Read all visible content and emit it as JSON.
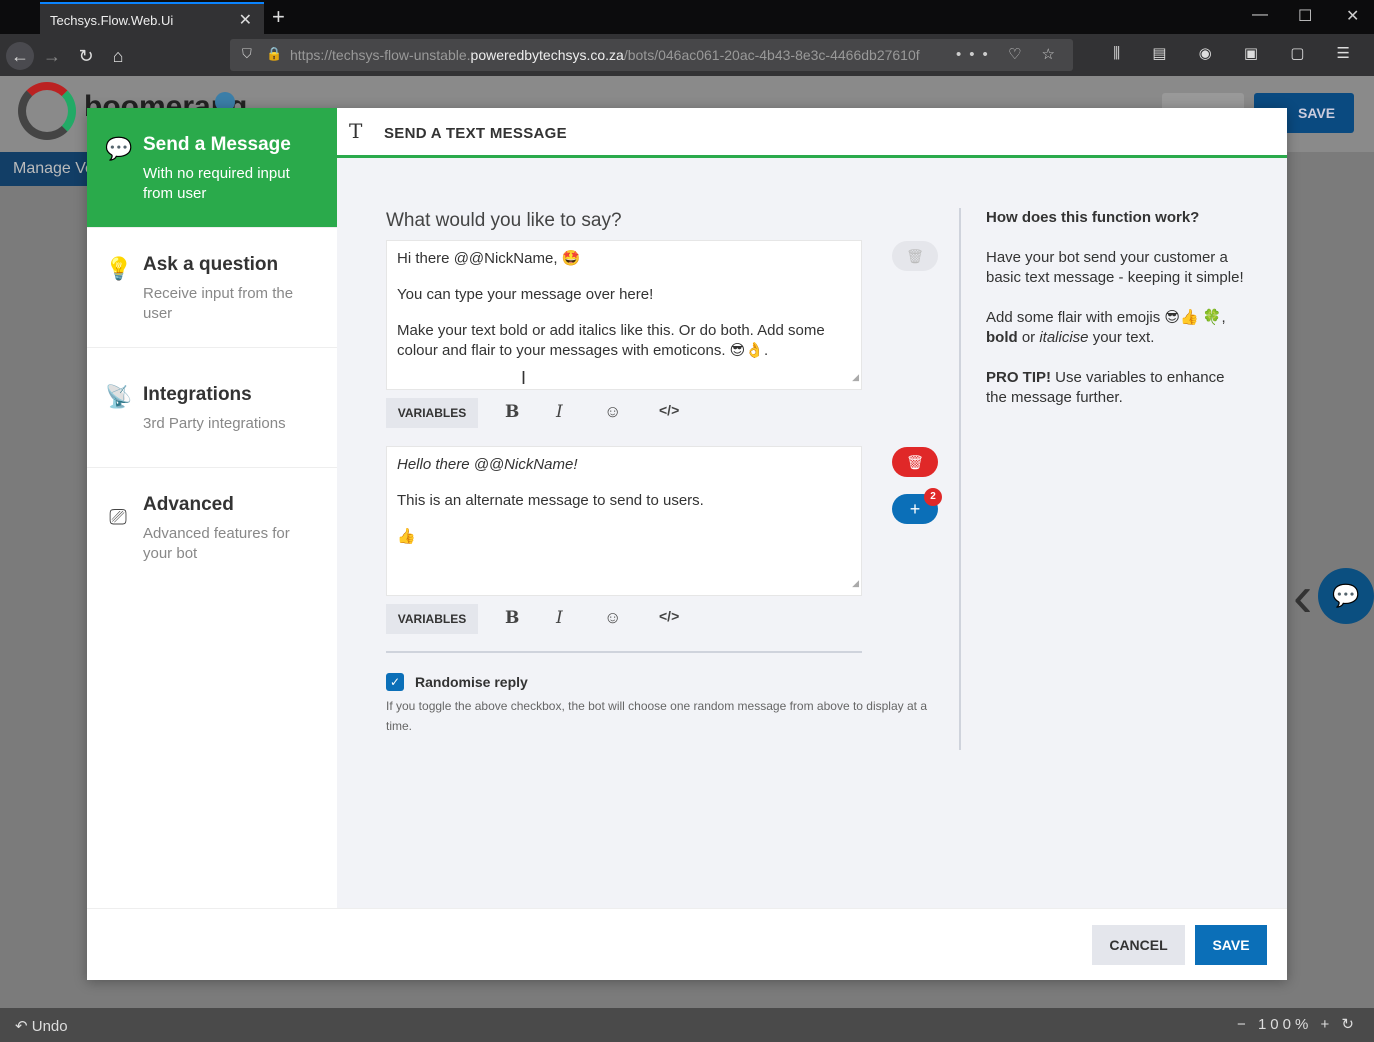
{
  "browser": {
    "tab_title": "Techsys.Flow.Web.Ui",
    "tab_close": "✕",
    "new_tab": "+",
    "url_prefix": "https://techsys-flow-unstable.",
    "url_host": "poweredbytechsys.co.za",
    "url_path": "/bots/046ac061-20ac-4b43-8e3c-4466db27610f",
    "url_actions": "••• ♡ ☆",
    "toolbar_icons": "⫼ ▤ ◉ ▣ ▢ ☰",
    "window_controls": [
      "—",
      "☐",
      "✕"
    ]
  },
  "background_app": {
    "logo_text": "boomerang",
    "save_label": "SAVE",
    "manage_label": "Manage Ve",
    "undo_label": "Undo",
    "zoom_level": "100%"
  },
  "sidebar": {
    "items": [
      {
        "title": "Send a Message",
        "desc": "With no required input from user",
        "icon": "chat-bubble-icon"
      },
      {
        "title": "Ask a question",
        "desc": "Receive input from the user",
        "icon": "lightbulb-icon"
      },
      {
        "title": "Integrations",
        "desc": "3rd Party integrations",
        "icon": "broadcast-icon"
      },
      {
        "title": "Advanced",
        "desc": "Advanced features for your bot",
        "icon": "cast-icon"
      }
    ]
  },
  "panel": {
    "title": "SEND A TEXT MESSAGE",
    "question": "What would you like to say?",
    "variables_label": "VARIABLES",
    "randomise_label": "Randomise reply",
    "randomise_checked": true,
    "randomise_help": "If you toggle the above checkbox, the bot will choose one random message from above to display at a time.",
    "add_badge": "2"
  },
  "messages": [
    {
      "lines": [
        "Hi there @@NickName, 🤩",
        "You can type your message over here!",
        "Make your text bold or add italics like this. Or do both. Add some colour and flair to your messages with emoticons. 😎👌."
      ]
    },
    {
      "lines": [
        "Hello there @@NickName!",
        "This is an alternate message to send to users.",
        "👍"
      ]
    }
  ],
  "help": {
    "heading": "How does this function work?",
    "p1": "Have your bot send your customer a basic text message - keeping it simple!",
    "p2a": "Add some flair with emojis 😎👍 🍀, ",
    "p2b": "bold",
    "p2c": " or ",
    "p2d": "italicise",
    "p2e": " your text.",
    "p3a": "PRO TIP!",
    "p3b": " Use variables to enhance the message further."
  },
  "footer": {
    "cancel_label": "CANCEL",
    "save_label": "SAVE"
  },
  "colors": {
    "accent_green": "#2aaa4b",
    "primary_blue": "#0b6fb8",
    "danger_red": "#e02828"
  }
}
